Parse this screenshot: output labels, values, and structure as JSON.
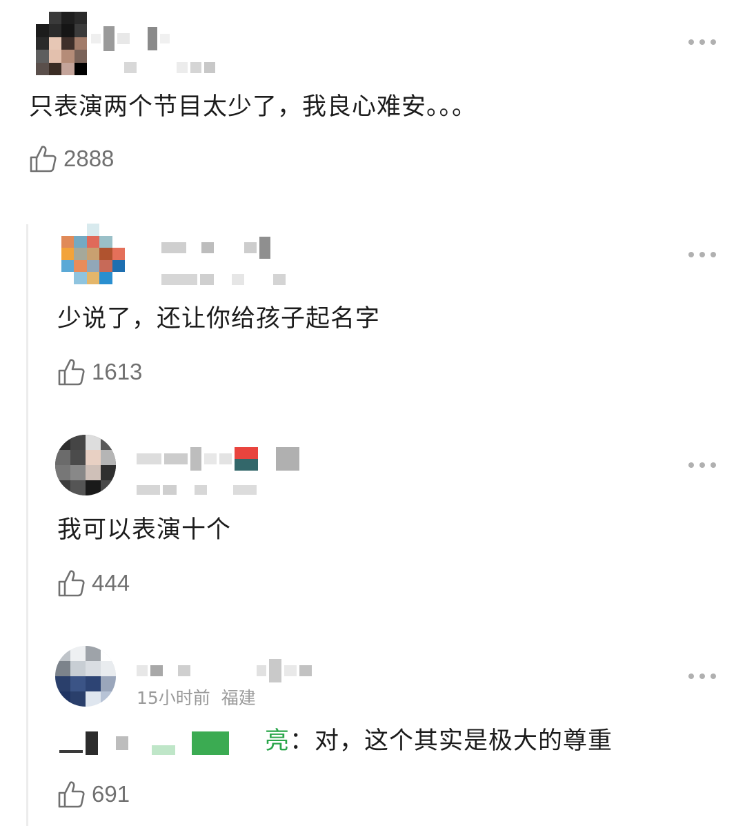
{
  "comments": [
    {
      "text": "只表演两个节目太少了，我良心难安。。。",
      "likes": "2888"
    },
    {
      "text": "少说了，还让你给孩子起名字",
      "likes": "1613"
    },
    {
      "text": "我可以表演十个",
      "likes": "444"
    },
    {
      "time": "15小时前",
      "location": "福建",
      "mention_tail": "亮",
      "text": "：对，这个其实是极大的尊重",
      "likes": "691"
    }
  ],
  "icons": {
    "like": "thumbs-up-icon",
    "more": "more-dots-icon"
  },
  "colors": {
    "mention": "#2aa64a",
    "secondary_text": "#707070",
    "thread_line": "#ececec"
  }
}
